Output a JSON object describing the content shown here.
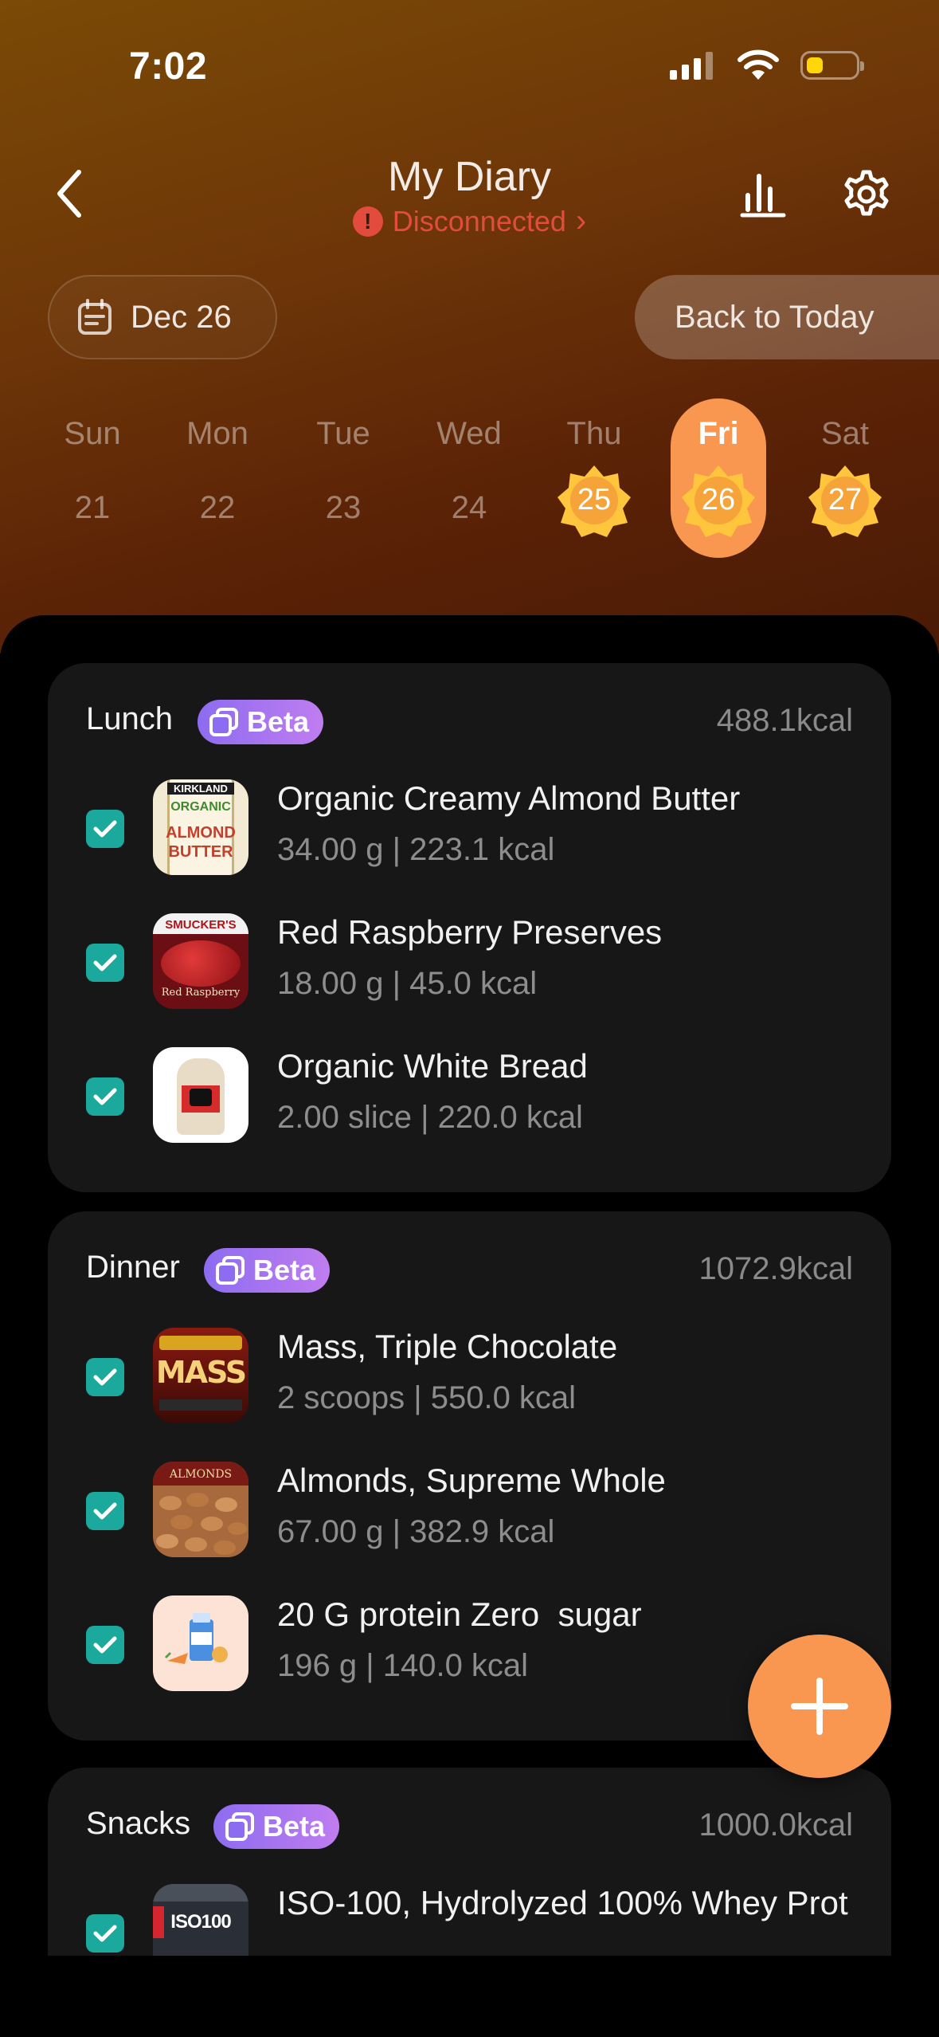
{
  "status_bar": {
    "time": "7:02",
    "battery_level": 0.35
  },
  "header": {
    "title": "My Diary",
    "connection_status": "Disconnected",
    "connection_chevron": "›",
    "icons": {
      "back": "chevron-left-icon",
      "stats": "bar-chart-icon",
      "settings": "gear-icon"
    }
  },
  "date_selector": {
    "current_date": "Dec 26",
    "back_to_today": "Back to Today",
    "accent_color": "#f99650"
  },
  "week": [
    {
      "name": "Sun",
      "date": "21",
      "badge": false,
      "selected": false
    },
    {
      "name": "Mon",
      "date": "22",
      "badge": false,
      "selected": false
    },
    {
      "name": "Tue",
      "date": "23",
      "badge": false,
      "selected": false
    },
    {
      "name": "Wed",
      "date": "24",
      "badge": false,
      "selected": false
    },
    {
      "name": "Thu",
      "date": "25",
      "badge": true,
      "selected": false
    },
    {
      "name": "Fri",
      "date": "26",
      "badge": true,
      "selected": true
    },
    {
      "name": "Sat",
      "date": "27",
      "badge": true,
      "selected": false
    }
  ],
  "meals": [
    {
      "name": "Lunch",
      "badge": "Beta",
      "kcal": "488.1kcal",
      "items": [
        {
          "name": "Organic Creamy Almond Butter",
          "detail": "34.00 g | 223.1 kcal",
          "checked": true,
          "thumb": "almond-butter-jar"
        },
        {
          "name": "Red Raspberry Preserves",
          "detail": "18.00 g | 45.0 kcal",
          "checked": true,
          "thumb": "raspberry-preserves-jar"
        },
        {
          "name": "Organic White Bread",
          "detail": "2.00 slice | 220.0 kcal",
          "checked": true,
          "thumb": "bread-loaf"
        }
      ]
    },
    {
      "name": "Dinner",
      "badge": "Beta",
      "kcal": "1072.9kcal",
      "items": [
        {
          "name": "Mass, Triple Chocolate",
          "detail": "2 scoops | 550.0 kcal",
          "checked": true,
          "thumb": "mass-gainer-tub"
        },
        {
          "name": "Almonds, Supreme Whole",
          "detail": "67.00 g | 382.9 kcal",
          "checked": true,
          "thumb": "almonds-bag"
        },
        {
          "name": "20 G protein Zero  sugar",
          "detail": "196 g | 140.0 kcal",
          "checked": true,
          "thumb": "milk-illustration"
        }
      ]
    },
    {
      "name": "Snacks",
      "badge": "Beta",
      "kcal": "1000.0kcal",
      "items": [
        {
          "name": "ISO-100, Hydrolyzed 100% Whey Prot",
          "detail": "",
          "checked": true,
          "thumb": "iso100-tub"
        }
      ]
    }
  ],
  "thumb_text": {
    "almond": {
      "brand": "KIRKLAND",
      "line1": "ORGANIC",
      "line2": "ALMOND",
      "line3": "BUTTER"
    },
    "raspberry": {
      "brand": "SMUCKER'S",
      "line1": "Red Raspberry"
    },
    "mass": {
      "line1": "MASS"
    },
    "almonds": {
      "line1": "ALMONDS"
    },
    "iso": {
      "line1": "ISO100"
    }
  },
  "fab": {
    "icon": "plus-icon"
  }
}
